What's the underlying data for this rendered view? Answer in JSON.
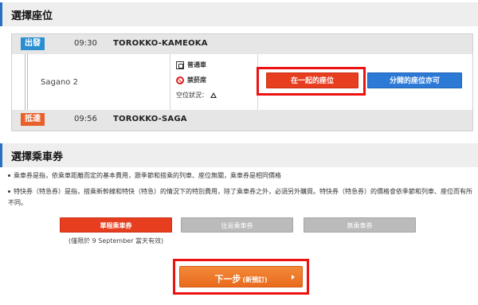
{
  "seat_section": {
    "title": "選擇座位",
    "departure": {
      "badge": "出發",
      "time": "09:30",
      "station": "TOROKKO-KAMEOKA"
    },
    "arrival": {
      "badge": "抵達",
      "time": "09:56",
      "station": "TOROKKO-SAGA"
    },
    "train": "Sagano 2",
    "car_type": "普通車",
    "smoking": "禁菸席",
    "status_label": "空位狀況：",
    "buttons": {
      "together": "在一起的座位",
      "separate": "分開的座位亦可"
    }
  },
  "ticket_section": {
    "title": "選擇乘車券",
    "note1": "乘車券是指，依乘車距離而定的基本費用，跟季節和搭乘的列車、座位無關，乘車券是相同價格",
    "note2": "特快券（特急券）是指，搭乘新幹線和特快（特急）的情況下的特別費用，除了乘車券之外，必須另外購買。特快券（特急券）的價格會依季節和列車、座位而有所不同。",
    "options": {
      "single": "單程乘車券",
      "round": "往返乘車券",
      "none": "無乘車券"
    },
    "validity": "(僅限於 9 September 當天有效)"
  },
  "next": {
    "main": "下一步",
    "sub": "(新預訂)"
  },
  "colors": {
    "accent_red": "#e63e1f",
    "accent_blue": "#2c7ad6",
    "highlight": "#ee1111",
    "next_orange": "#ea6a1c"
  }
}
